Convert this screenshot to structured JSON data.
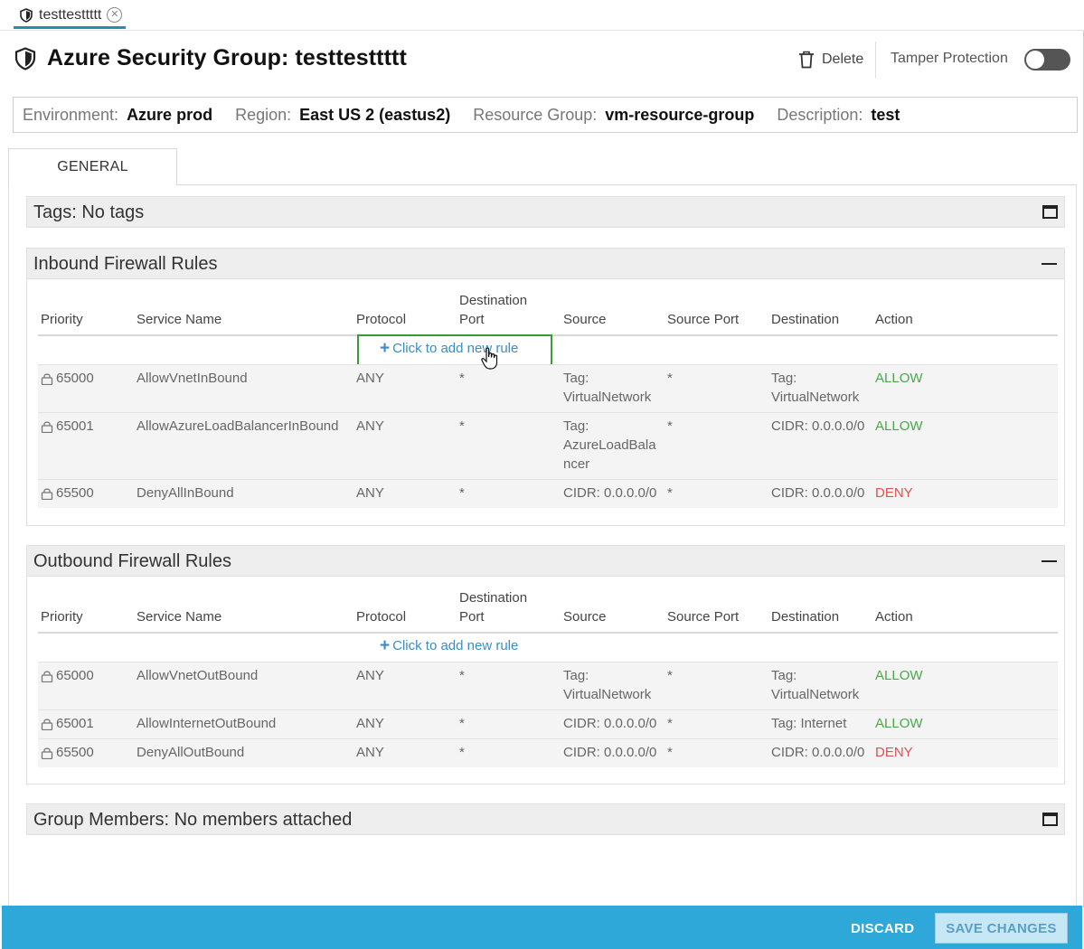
{
  "tab": {
    "label": "testtesttttt"
  },
  "header": {
    "title": "Azure Security Group: testtesttttt",
    "delete_label": "Delete",
    "tamper_label": "Tamper Protection",
    "tamper_enabled": false
  },
  "info": {
    "environment_label": "Environment:",
    "environment": "Azure prod",
    "region_label": "Region:",
    "region": "East US 2 (eastus2)",
    "resource_group_label": "Resource Group:",
    "resource_group": "vm-resource-group",
    "description_label": "Description:",
    "description": "test"
  },
  "tabs": {
    "general": "GENERAL"
  },
  "tags_panel": {
    "title": "Tags: No tags"
  },
  "columns": {
    "priority": "Priority",
    "service_name": "Service Name",
    "protocol": "Protocol",
    "destination_port_1": "Destination",
    "destination_port_2": "Port",
    "source": "Source",
    "source_port": "Source Port",
    "destination": "Destination",
    "action": "Action"
  },
  "add_rule": {
    "label": "Click to add new rule",
    "plus": "+"
  },
  "inbound": {
    "title": "Inbound Firewall Rules",
    "rows": [
      {
        "priority": "65000",
        "name": "AllowVnetInBound",
        "protocol": "ANY",
        "dport": "*",
        "source": "Tag:\nVirtualNetwork",
        "sport": "*",
        "destination": "Tag:\nVirtualNetwork",
        "action": "ALLOW"
      },
      {
        "priority": "65001",
        "name": "AllowAzureLoadBalancerInBound",
        "protocol": "ANY",
        "dport": "*",
        "source": "Tag:\nAzureLoadBala\nncer",
        "sport": "*",
        "destination": "CIDR: 0.0.0.0/0",
        "action": "ALLOW"
      },
      {
        "priority": "65500",
        "name": "DenyAllInBound",
        "protocol": "ANY",
        "dport": "*",
        "source": "CIDR: 0.0.0.0/0",
        "sport": "*",
        "destination": "CIDR: 0.0.0.0/0",
        "action": "DENY"
      }
    ]
  },
  "outbound": {
    "title": "Outbound Firewall Rules",
    "rows": [
      {
        "priority": "65000",
        "name": "AllowVnetOutBound",
        "protocol": "ANY",
        "dport": "*",
        "source": "Tag:\nVirtualNetwork",
        "sport": "*",
        "destination": "Tag:\nVirtualNetwork",
        "action": "ALLOW"
      },
      {
        "priority": "65001",
        "name": "AllowInternetOutBound",
        "protocol": "ANY",
        "dport": "*",
        "source": "CIDR: 0.0.0.0/0",
        "sport": "*",
        "destination": "Tag: Internet",
        "action": "ALLOW"
      },
      {
        "priority": "65500",
        "name": "DenyAllOutBound",
        "protocol": "ANY",
        "dport": "*",
        "source": "CIDR: 0.0.0.0/0",
        "sport": "*",
        "destination": "CIDR: 0.0.0.0/0",
        "action": "DENY"
      }
    ]
  },
  "members_panel": {
    "title": "Group Members: No members attached"
  },
  "footer": {
    "discard": "DISCARD",
    "save": "SAVE CHANGES"
  },
  "colors": {
    "accent": "#2ea8d8",
    "allow": "#4aa84a",
    "deny": "#e05050",
    "link": "#3b8dc4"
  }
}
